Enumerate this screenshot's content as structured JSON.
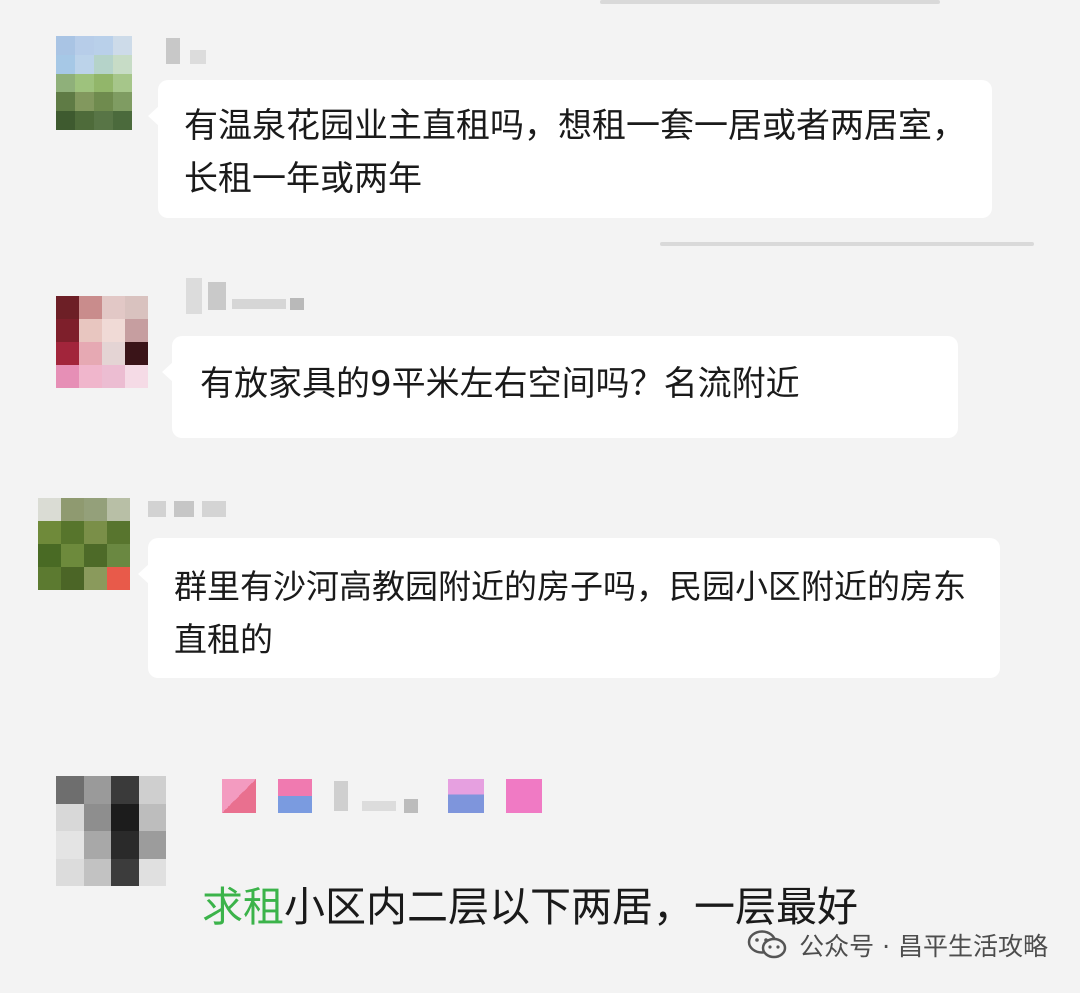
{
  "messages": [
    {
      "text": "有温泉花园业主直租吗，想租一套一居或者两居室，长租一年或两年"
    },
    {
      "text": "有放家具的9平米左右空间吗？名流附近"
    },
    {
      "text": "群里有沙河高教园附近的房子吗，民园小区附近的房东直租的"
    },
    {
      "tag": "求租",
      "text": "小区内二层以下两居，一层最好"
    }
  ],
  "watermark": {
    "icon": "wechat-icon",
    "label": "公众号 · 昌平生活攻略"
  },
  "colors": {
    "background": "#f3f3f3",
    "bubble": "#ffffff",
    "tag_green": "#3bb34a"
  }
}
